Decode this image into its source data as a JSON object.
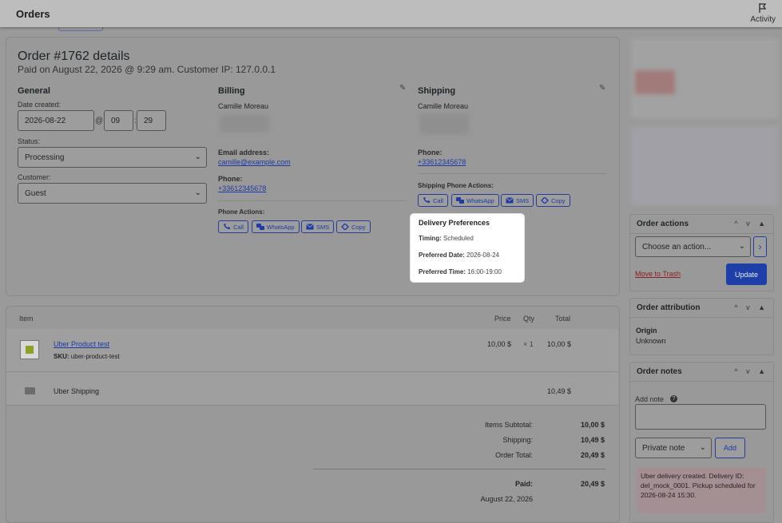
{
  "topbar": {
    "title": "Orders",
    "activity_label": "Activity"
  },
  "order": {
    "heading": "Order #1762 details",
    "subheading": "Paid on August 22, 2026 @ 9:29 am. Customer IP: 127.0.0.1"
  },
  "general": {
    "heading": "General",
    "date_label": "Date created:",
    "date_value": "2026-08-22",
    "at": "@",
    "hour": "09",
    "colon": ":",
    "minute": "29",
    "status_label": "Status:",
    "status_value": "Processing",
    "customer_label": "Customer:",
    "customer_value": "Guest"
  },
  "billing": {
    "heading": "Billing",
    "name": "Camille Moreau",
    "email_label": "Email address:",
    "email": "camille@example.com",
    "phone_label": "Phone:",
    "phone": "+33612345678",
    "actions_label": "Phone Actions:",
    "actions": [
      "Call",
      "WhatsApp",
      "SMS",
      "Copy"
    ]
  },
  "shipping": {
    "heading": "Shipping",
    "name": "Camille Moreau",
    "phone_label": "Phone:",
    "phone": "+33612345678",
    "actions_label": "Shipping Phone Actions:",
    "actions": [
      "Call",
      "WhatsApp",
      "SMS",
      "Copy"
    ]
  },
  "delivery": {
    "title": "Delivery Preferences",
    "timing_label": "Timing:",
    "timing_value": "Scheduled",
    "date_label": "Preferred Date:",
    "date_value": "2026-08-24",
    "time_label": "Preferred Time:",
    "time_value": "16:00-19:00"
  },
  "items": {
    "col_item": "Item",
    "col_price": "Price",
    "col_qty": "Qty",
    "col_total": "Total",
    "product_name": "Uber Product test",
    "sku_label": "SKU:",
    "sku": "uber-product-test",
    "price": "10,00 $",
    "qty": "× 1",
    "total": "10,00 $",
    "shipping_name": "Uber Shipping",
    "shipping_total": "10,49 $",
    "subtotal_label": "Items Subtotal:",
    "subtotal": "10,00 $",
    "shipping_label": "Shipping:",
    "shipping_value": "10,49 $",
    "order_total_label": "Order Total:",
    "order_total": "20,49 $",
    "paid_label": "Paid:",
    "paid": "20,49 $",
    "paid_date": "August 22, 2026"
  },
  "order_actions": {
    "heading": "Order actions",
    "select": "Choose an action...",
    "go": "›",
    "trash": "Move to Trash",
    "update": "Update"
  },
  "attribution": {
    "heading": "Order attribution",
    "origin_label": "Origin",
    "origin_value": "Unknown"
  },
  "notes": {
    "heading": "Order notes",
    "add_label": "Add note",
    "help": "?",
    "type": "Private note",
    "add_button": "Add",
    "note_text": "Uber delivery created. Delivery ID: del_mock_0001. Pickup scheduled for 2026-08-24 15:30."
  },
  "panel_controls": "^ v ▲",
  "colors": {
    "accent": "#1f3fa8",
    "overlay": "#999999",
    "popup": "#ffffff",
    "note": "#a48f93"
  }
}
